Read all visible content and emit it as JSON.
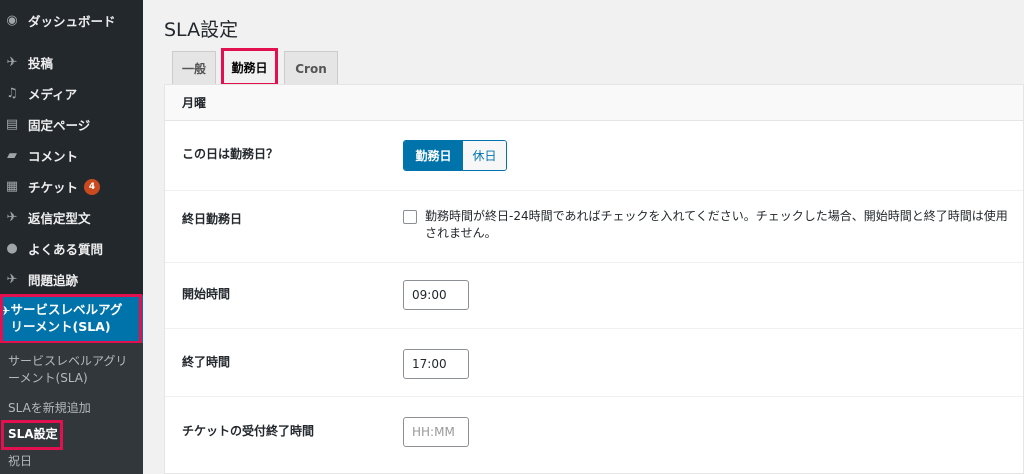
{
  "sidebar": {
    "items": [
      {
        "label": "ダッシュボード",
        "icon": "dashboard-icon"
      },
      {
        "label": "投稿",
        "icon": "pin-icon"
      },
      {
        "label": "メディア",
        "icon": "media-icon"
      },
      {
        "label": "固定ページ",
        "icon": "page-icon"
      },
      {
        "label": "コメント",
        "icon": "comment-icon"
      },
      {
        "label": "チケット",
        "icon": "ticket-icon",
        "badge": "4"
      },
      {
        "label": "返信定型文",
        "icon": "pin-icon"
      },
      {
        "label": "よくある質問",
        "icon": "question-icon"
      },
      {
        "label": "問題追跡",
        "icon": "pin-icon"
      }
    ],
    "current": {
      "label": "サービスレベルアグリーメント(SLA)",
      "icon": "pin-icon"
    },
    "submenu": [
      {
        "label": "サービスレベルアグリーメント(SLA)"
      },
      {
        "label": "SLAを新規追加"
      },
      {
        "label": "SLA設定"
      },
      {
        "label": "祝日"
      }
    ]
  },
  "main": {
    "title": "SLA設定",
    "tabs": [
      {
        "label": "一般"
      },
      {
        "label": "勤務日"
      },
      {
        "label": "Cron"
      }
    ],
    "panel": {
      "heading": "月曜",
      "workday": {
        "label": "この日は勤務日？",
        "on": "勤務日",
        "off": "休日"
      },
      "allday": {
        "label": "終日勤務日",
        "text": "勤務時間が終日-24時間であればチェックを入れてください。チェックした場合、開始時間と終了時間は使用されません。"
      },
      "start": {
        "label": "開始時間",
        "value": "09:00"
      },
      "end": {
        "label": "終了時間",
        "value": "17:00"
      },
      "cutoff": {
        "label": "チケットの受付終了時間",
        "placeholder": "HH:MM"
      }
    }
  },
  "colors": {
    "sidebar_bg": "#23282d",
    "accent": "#0073aa",
    "highlight": "#e2104f",
    "badge": "#ca4a1f"
  }
}
